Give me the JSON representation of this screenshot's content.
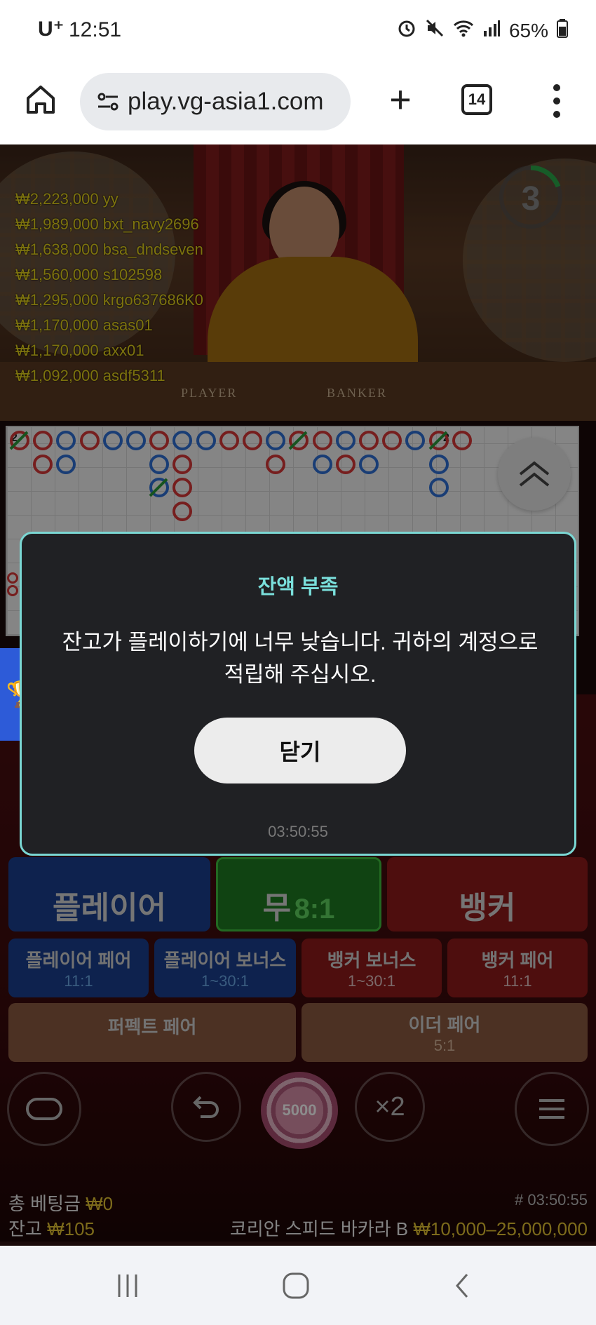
{
  "status_bar": {
    "carrier": "U⁺",
    "time": "12:51",
    "battery": "65%",
    "icons": [
      "alarm-icon",
      "mute-icon",
      "wifi-icon",
      "signal-icon",
      "battery-icon"
    ]
  },
  "browser": {
    "url": "play.vg-asia1.com",
    "tab_count": "14",
    "icons": [
      "home-icon",
      "site-settings-icon",
      "new-tab-icon",
      "tabs-icon",
      "more-icon"
    ]
  },
  "video": {
    "table_labels": [
      "PLAYER",
      "BANKER"
    ],
    "countdown": "3",
    "winners": [
      {
        "amount": "₩2,223,000",
        "name": "yy"
      },
      {
        "amount": "₩1,989,000",
        "name": "bxt_navy2696"
      },
      {
        "amount": "₩1,638,000",
        "name": "bsa_dndseven"
      },
      {
        "amount": "₩1,560,000",
        "name": "s102598"
      },
      {
        "amount": "₩1,295,000",
        "name": "krgo637686K0"
      },
      {
        "amount": "₩1,170,000",
        "name": "asas01"
      },
      {
        "amount": "₩1,170,000",
        "name": "axx01"
      },
      {
        "amount": "₩1,092,000",
        "name": "asdf5311"
      }
    ]
  },
  "roadmap": {
    "tags": [
      "2",
      "2"
    ],
    "colors": {
      "banker": "#d83838",
      "player": "#2f6fd6",
      "tie": "#2a9a3a"
    }
  },
  "bets": {
    "player": "플레이어",
    "tie": "무",
    "tie_odds": "8:1",
    "banker": "뱅커",
    "player_pair": "플레이어 페어",
    "player_pair_odds": "11:1",
    "player_bonus": "플레이어 보너스",
    "player_bonus_odds": "1~30:1",
    "banker_bonus": "뱅커 보너스",
    "banker_bonus_odds": "1~30:1",
    "banker_pair": "뱅커 페어",
    "banker_pair_odds": "11:1",
    "perfect_pair": "퍼펙트 페어",
    "either_pair": "이더 페어",
    "either_pair_odds": "5:1"
  },
  "controls": {
    "chip_value": "5000",
    "double": "×2",
    "icons": [
      "lobby-icon",
      "undo-icon",
      "menu-icon"
    ]
  },
  "footer": {
    "total_bet_label": "총 베팅금",
    "total_bet": "₩0",
    "balance_label": "잔고",
    "balance": "₩105",
    "round_id": "# 03:50:55",
    "table_name": "코리안 스피드 바카라 B",
    "limits": "₩10,000–25,000,000"
  },
  "modal": {
    "title": "잔액 부족",
    "message": "잔고가 플레이하기에 너무 낮습니다. 귀하의 계정으로 적립해 주십시오.",
    "button": "닫기",
    "timestamp": "03:50:55"
  },
  "nav": {
    "icons": [
      "recent-apps-icon",
      "home-nav-icon",
      "back-icon"
    ]
  }
}
